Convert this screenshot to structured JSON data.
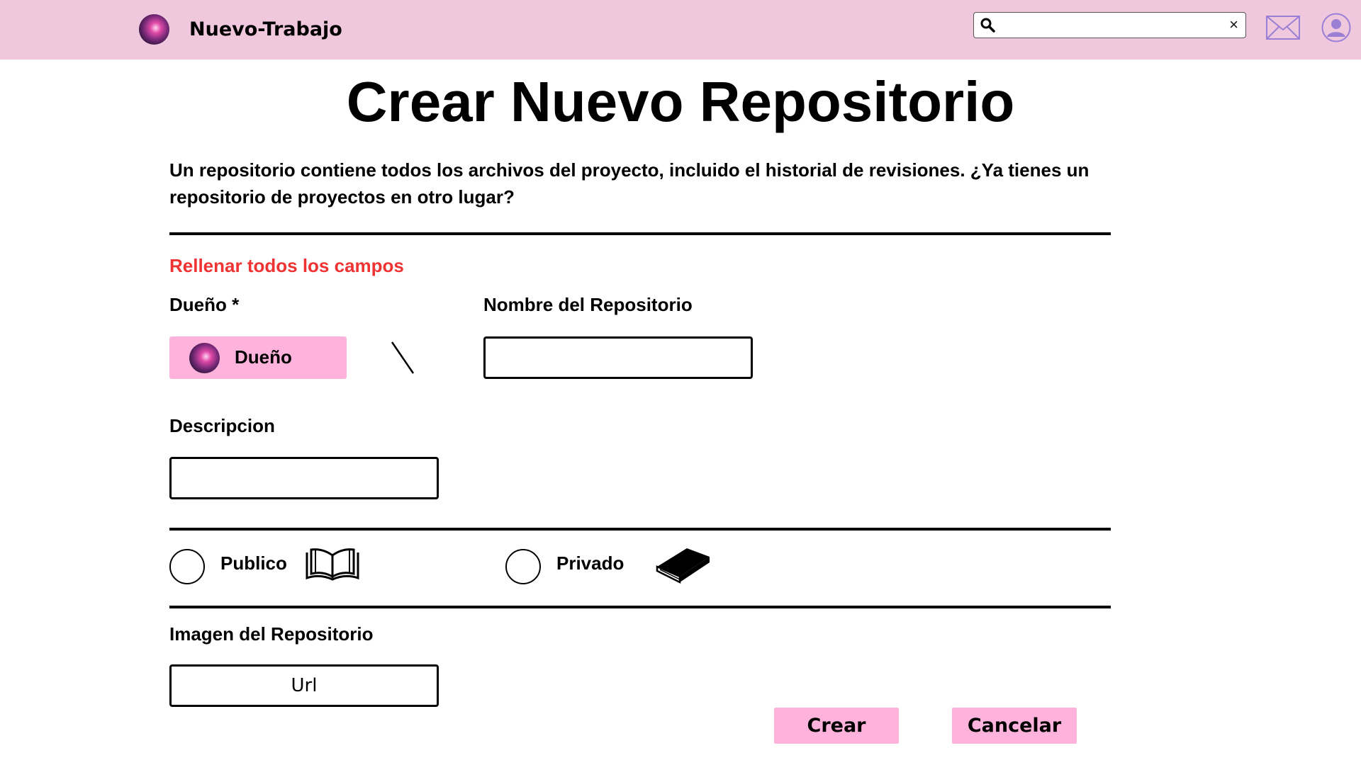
{
  "header": {
    "app_title": "Nuevo-Trabajo",
    "search": {
      "placeholder": "",
      "value": ""
    },
    "clear_glyph": "×"
  },
  "page": {
    "title": "Crear Nuevo Repositorio",
    "intro": "Un repositorio contiene todos los archivos del proyecto, incluido el historial de revisiones. ¿Ya tienes un repositorio de proyectos en otro lugar?",
    "required_warning": "Rellenar todos los campos"
  },
  "form": {
    "owner": {
      "label": "Dueño *",
      "button_label": "Dueño"
    },
    "repo_name": {
      "label": "Nombre del Repositorio",
      "value": ""
    },
    "description": {
      "label": "Descripcion",
      "value": ""
    },
    "visibility": {
      "public_label": "Publico",
      "private_label": "Privado",
      "selected": "none"
    },
    "image": {
      "label": "Imagen del Repositorio",
      "placeholder": "Url",
      "value": ""
    }
  },
  "actions": {
    "create_label": "Crear",
    "cancel_label": "Cancelar"
  },
  "colors": {
    "header_bg": "#efc8de",
    "button_bg": "#ffb3dc",
    "warning": "#ef3333",
    "icon_accent": "#9b7fd4"
  },
  "icons": {
    "search": "search-icon",
    "clear": "close-icon",
    "mail": "mail-icon",
    "user": "user-icon",
    "public": "open-book-icon",
    "private": "closed-book-icon"
  }
}
